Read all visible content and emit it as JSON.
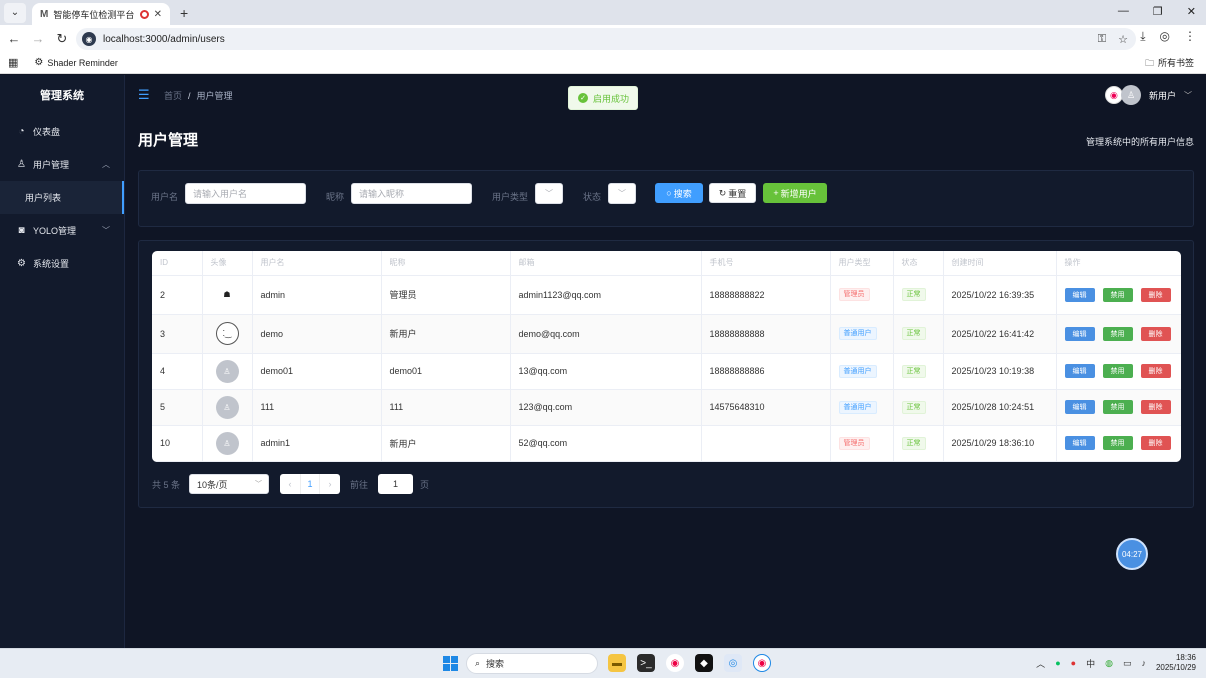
{
  "browser": {
    "tab_title": "智能停车位检测平台",
    "url": "localhost:3000/admin/users",
    "bookmark": "Shader Reminder",
    "bookmarks_right": "所有书签"
  },
  "sidebar": {
    "title": "管理系统",
    "items": [
      {
        "label": "仪表盘",
        "icon": "dashboard-icon"
      },
      {
        "label": "用户管理",
        "icon": "user-icon",
        "expanded": true
      },
      {
        "label": "用户列表",
        "sub": true,
        "active": true
      },
      {
        "label": "YOLO管理",
        "icon": "camera-icon",
        "expanded": false
      },
      {
        "label": "系统设置",
        "icon": "gear-icon"
      }
    ]
  },
  "header": {
    "breadcrumb_home": "首页",
    "breadcrumb_current": "用户管理",
    "toast": "启用成功",
    "user_name": "新用户"
  },
  "page": {
    "title": "用户管理",
    "description": "管理系统中的所有用户信息"
  },
  "filters": {
    "username_label": "用户名",
    "username_placeholder": "请输入用户名",
    "nickname_label": "昵称",
    "nickname_placeholder": "请输入昵称",
    "usertype_label": "用户类型",
    "status_label": "状态",
    "search_label": "搜索",
    "reset_label": "重置",
    "add_label": "新增用户"
  },
  "table": {
    "columns": [
      "ID",
      "头像",
      "用户名",
      "昵称",
      "邮箱",
      "手机号",
      "用户类型",
      "状态",
      "创建时间",
      "操作"
    ],
    "rows": [
      {
        "id": "2",
        "avatar": "image",
        "username": "admin",
        "nickname": "管理员",
        "email": "admin1123@qq.com",
        "phone": "18888888822",
        "type": "管理员",
        "type_kind": "admin",
        "status": "正常",
        "created": "2025/10/22 16:39:35"
      },
      {
        "id": "3",
        "avatar": "face",
        "username": "demo",
        "nickname": "新用户",
        "email": "demo@qq.com",
        "phone": "18888888888",
        "type": "普通用户",
        "type_kind": "user",
        "status": "正常",
        "created": "2025/10/22 16:41:42"
      },
      {
        "id": "4",
        "avatar": "default",
        "username": "demo01",
        "nickname": "demo01",
        "email": "13@qq.com",
        "phone": "18888888886",
        "type": "普通用户",
        "type_kind": "user",
        "status": "正常",
        "created": "2025/10/23 10:19:38"
      },
      {
        "id": "5",
        "avatar": "default",
        "username": "111",
        "nickname": "111",
        "email": "123@qq.com",
        "phone": "14575648310",
        "type": "普通用户",
        "type_kind": "user",
        "status": "正常",
        "created": "2025/10/28 10:24:51"
      },
      {
        "id": "10",
        "avatar": "default",
        "username": "admin1",
        "nickname": "新用户",
        "email": "52@qq.com",
        "phone": "",
        "type": "管理员",
        "type_kind": "admin",
        "status": "正常",
        "created": "2025/10/29 18:36:10"
      }
    ],
    "actions": {
      "edit": "编辑",
      "disable": "禁用",
      "delete": "删除"
    }
  },
  "pagination": {
    "total": "共 5 条",
    "page_size": "10条/页",
    "current_page": "1",
    "goto_label": "前往",
    "goto_value": "1",
    "goto_unit": "页"
  },
  "timer": "04:27",
  "taskbar": {
    "search_placeholder": "搜索",
    "ime": "中",
    "time": "18:36",
    "date": "2025/10/29"
  },
  "colors": {
    "primary": "#409eff",
    "success": "#67c23a",
    "danger": "#f56c6c",
    "sidebar_bg": "#121a2c",
    "app_bg": "#0f1525"
  }
}
